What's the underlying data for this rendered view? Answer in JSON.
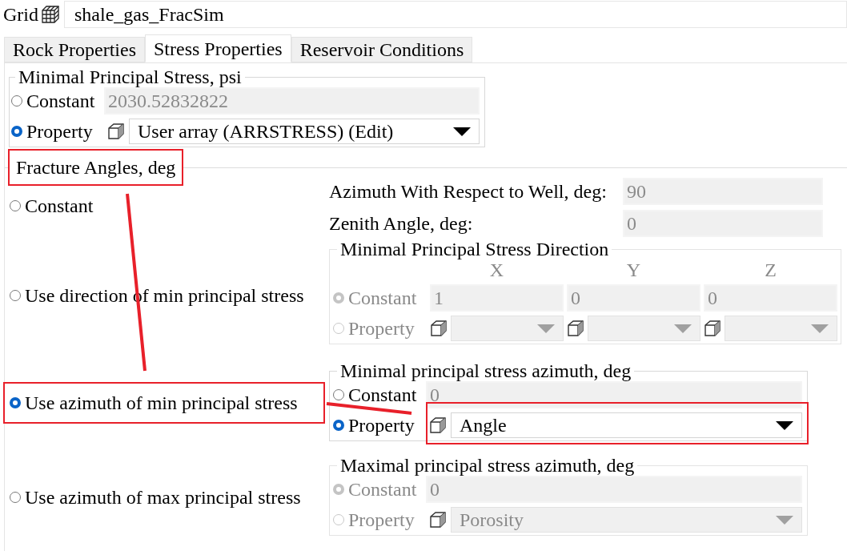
{
  "grid": {
    "label": "Grid",
    "value": "shale_gas_FracSim"
  },
  "tabs": [
    {
      "label": "Rock Properties",
      "selected": false
    },
    {
      "label": "Stress Properties",
      "selected": true
    },
    {
      "label": "Reservoir Conditions",
      "selected": false
    }
  ],
  "min_stress": {
    "legend": "Minimal Principal Stress, psi",
    "disabled": false,
    "options": [
      {
        "label": "Constant",
        "selected": false,
        "kind": "input",
        "value": "2030.52832822"
      },
      {
        "label": "Property",
        "selected": true,
        "kind": "dropdown",
        "value": "User array (ARRSTRESS) (Edit)"
      }
    ]
  },
  "fracture_angles": {
    "legend": "Fracture Angles, deg",
    "modes": [
      {
        "label": "Constant",
        "selected": false
      },
      {
        "label": "Use direction of min principal stress",
        "selected": false
      },
      {
        "label": "Use azimuth of min principal stress",
        "selected": true
      },
      {
        "label": "Use azimuth of max principal stress",
        "selected": false
      }
    ],
    "fields": [
      {
        "label": "Azimuth With Respect to Well, deg:",
        "value": "90"
      },
      {
        "label": "Zenith Angle, deg:",
        "value": "0"
      }
    ],
    "direction": {
      "legend": "Minimal Principal Stress Direction",
      "disabled": true,
      "columns": [
        "X",
        "Y",
        "Z"
      ],
      "options": [
        {
          "label": "Constant",
          "selected": true,
          "kind": "inputs",
          "values": [
            "1",
            "0",
            "0"
          ]
        },
        {
          "label": "Property",
          "selected": false,
          "kind": "dropdowns"
        }
      ]
    },
    "min_azimuth": {
      "legend": "Minimal principal stress azimuth, deg",
      "disabled": false,
      "options": [
        {
          "label": "Constant",
          "selected": false,
          "kind": "input",
          "value": "0"
        },
        {
          "label": "Property",
          "selected": true,
          "kind": "dropdown",
          "value": "Angle"
        }
      ]
    },
    "max_azimuth": {
      "legend": "Maximal principal stress azimuth, deg",
      "disabled": true,
      "options": [
        {
          "label": "Constant",
          "selected": true,
          "kind": "input",
          "value": "0"
        },
        {
          "label": "Property",
          "selected": false,
          "kind": "dropdown",
          "value": "Porosity"
        }
      ]
    }
  }
}
